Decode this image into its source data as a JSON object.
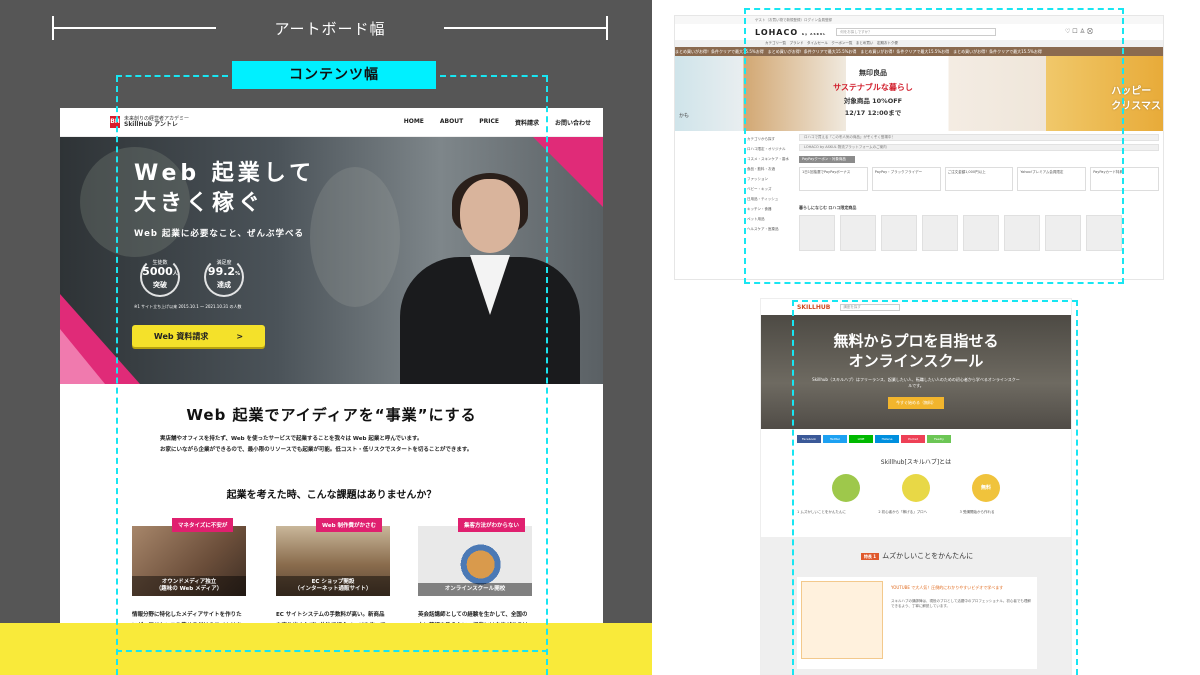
{
  "left": {
    "artboard_label": "アートボード幅",
    "content_label": "コンテンツ幅"
  },
  "mock": {
    "logo_box": "BH",
    "logo_line1": "未来創りの経営者アカデミー",
    "logo_line2": "SkillHub アントレ",
    "nav": [
      "HOME",
      "ABOUT",
      "PRICE",
      "資料請求",
      "お問い合わせ"
    ],
    "hero_title_1": "Web 起業して",
    "hero_title_2": "大きく稼ぐ",
    "hero_sub": "Web 起業に必要なこと、ぜんぶ学べる",
    "badge1_label": "生徒数",
    "badge1_value": "5000",
    "badge1_unit": "人",
    "badge1_tail": "突破",
    "badge2_label": "満足度",
    "badge2_value": "99.2",
    "badge2_unit": "%",
    "badge2_tail": "達成",
    "hero_note": "※1 サイト立ち上げ以来 2015.10.1 ～ 2021.10.31 の人数",
    "cta_label": "Web 資料請求",
    "cta_arrow": ">",
    "section_title": "Web 起業でアイディアを“事業”にする",
    "section_text_1": "実店舗やオフィスを持たず、Web を使ったサービスで起業することを我々は Web 起業と呼んでいます。",
    "section_text_2": "お家にいながら企業ができるので、最小限のリソースでも起業が可能。低コスト・低リスクでスタートを切ることができます。",
    "problem_title": "起業を考えた時、こんな課題はありませんか？",
    "cards": [
      {
        "tag": "マネタイズに不安が",
        "cap1": "オウンドメディア独立",
        "cap2": "（趣味の Web メディア）",
        "desc": "情報分野に特化したメディアサイトを作りたいが、アドセンスを載せるだけのサイトはちょっと…。ビジネスとして発展させていくために、どうすれば良いか知りたい。"
      },
      {
        "tag": "Web 制作費がかさむ",
        "cap1": "EC ショップ開設",
        "cap2": "（インターネット通販サイト）",
        "desc": "EC サイトシステムの手数料が高い。新商品を売り出すたびに外注で紹介ページを作ってもらうと、利益が出ないか赤字になってしまいそうで不安…。"
      },
      {
        "tag": "集客方法がわからない",
        "cap1": "オンラインスクール開校",
        "cap2": "",
        "desc": "英会話講師としての経験を生かして、全国の人に英語を教えたい。授業には自信があるけれど、集客やマーケティングって結局何をすれば良いのかわからない。"
      }
    ]
  },
  "lohaco": {
    "topbar": "ゲスト（お買い物で新規登録）ログイン会員登録",
    "logo": "LOHACO",
    "logo_sub": "by ASKUL",
    "search_placeholder": "何をお探しですか？",
    "navrow": "カテゴリ一覧　ブランド　タイムセール　クーポン一覧　まとめ買い　定期おトク便",
    "ticker": "まとめ買いがお得！条件クリアで最大15.5%お得　まとめ買いがお得！条件クリアで最大15.5%お得　まとめ買いがお得！条件クリアで最大15.5%お得　まとめ買いがお得！条件クリアで最大15.5%お得",
    "banner_a": "無印良品",
    "banner_b": "サステナブルな暮らし",
    "banner_c": "対象商品 10%OFF",
    "banner_d": "12/17 12:00まで",
    "banner_right_1": "ハッピー",
    "banner_right_2": "クリスマス",
    "banner_left": "かも",
    "sidebar": [
      "カテゴリから探す",
      "ロハコ限定・オリジナル",
      "コスメ・スキンケア・香水",
      "食品・飲料・お酒",
      "ファッション",
      "ベビー・キッズ",
      "日用品・ティッシュ",
      "キッチン・食器",
      "ペット用品",
      "ヘルスケア・医薬品"
    ],
    "bar1": "ロハコで買える「この冬人気の商品」がぞくぞく登場中！",
    "bar2": "LOHACO by ASKUL 物流プラットフォームのご案内",
    "coupon_head": "PayPayクーポン・対象商品",
    "coupons": [
      "1日1回抽選でPayPayボーナス",
      "PayPay・ブラックフライデー",
      "ご注文金額1,000円以上",
      "Yahoo!プレミアム会員限定",
      "PayPayカード特典"
    ],
    "prod_head": "暮らしになじむ ロハコ限定商品"
  },
  "skillhub": {
    "logo": "SKILLHUB",
    "search_placeholder": "講座を探す",
    "hero_t1": "無料からプロを目指せる",
    "hero_t2": "オンラインスクール",
    "hero_desc": "Skillhub（スキルハブ）はフリーランス、起業したい人、転職したい人のための初心者から学べるオンラインスクールです。",
    "hero_btn": "今すぐ始める（無料）",
    "social": [
      "Facebook",
      "Twitter",
      "LINE",
      "Hatena",
      "Pocket",
      "Feedly"
    ],
    "about": "Skillhub[スキルハブ]とは",
    "circles": [
      "",
      "",
      "無料"
    ],
    "points": [
      "1 ムズかしいことをかんたんに",
      "2 初心者から「稼げる」プロへ",
      "3 受講開始から作れる"
    ],
    "gray_tag": "特長 1",
    "gray_title": "ムズかしいことをかんたんに",
    "gray_txt": "YOUTUBE で大人気！圧倒的にわかりやすいビデオで学べます",
    "gray_txt2": "スキルハブの講師陣は、現役のプロとして活躍中のプロフェッショナル。初心者でも理解できるよう、丁寧に解説しています。"
  }
}
